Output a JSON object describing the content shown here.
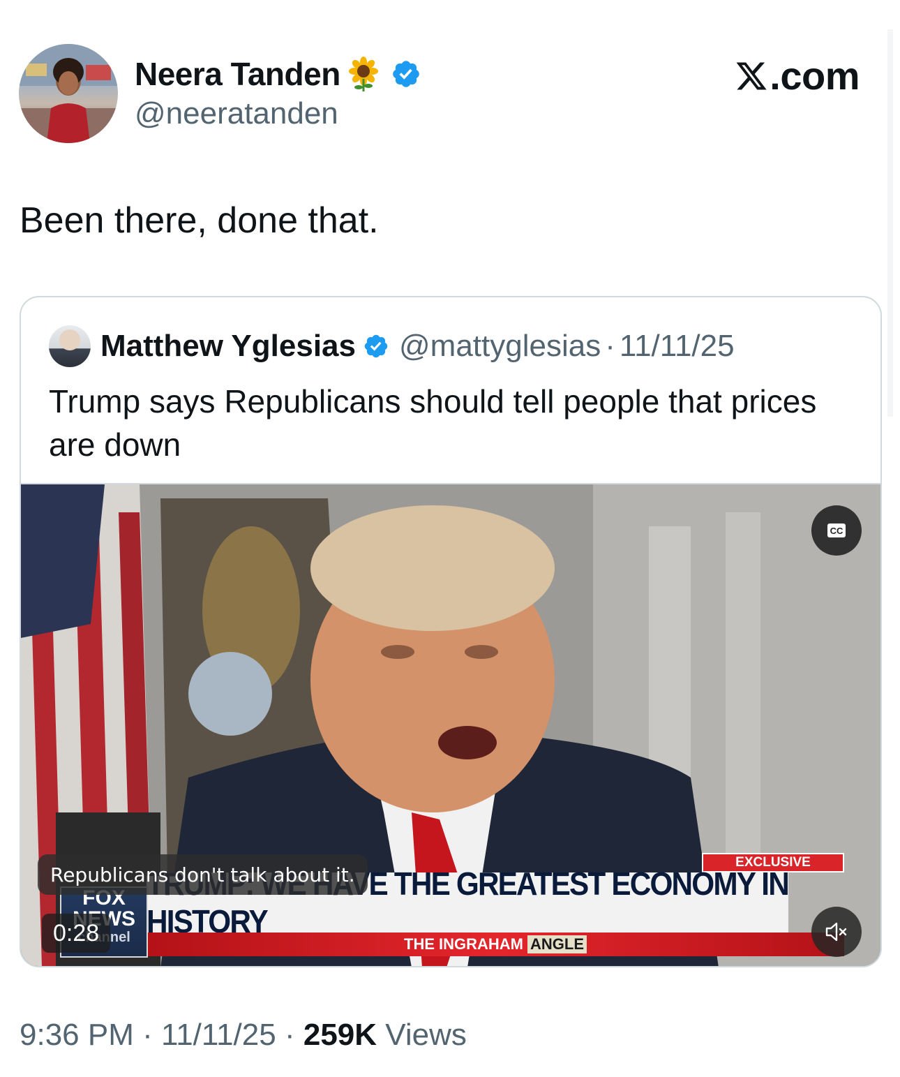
{
  "author": {
    "name": "Neera Tanden",
    "handle": "@neeratanden",
    "name_emoji": "sunflower-icon",
    "verified": true
  },
  "site_label": ".com",
  "tweet": {
    "text": "Been there, done that."
  },
  "quoted_tweet": {
    "name": "Matthew Yglesias",
    "handle": "@mattyglesias",
    "separator": "·",
    "date": "11/11/25",
    "verified": true,
    "text": "Trump says Republicans should tell people that prices are down",
    "video": {
      "caption": "Republicans don't talk about it.",
      "duration": "0:28",
      "cc_label": "CC",
      "chyron": {
        "tag": "EXCLUSIVE",
        "headline": "TRUMP: WE HAVE THE GREATEST ECONOMY IN HISTORY",
        "show_prefix": "THE",
        "show_name": "INGRAHAM",
        "show_suffix": "ANGLE"
      },
      "network_logo": {
        "line1": "FOX",
        "line2": "NEWS",
        "line3": "channel"
      }
    }
  },
  "meta": {
    "time": "9:36 PM",
    "sep1": " · ",
    "date": "11/11/25",
    "sep2": " · ",
    "views_count": "259K",
    "views_label": "Views"
  },
  "colors": {
    "verified_blue": "#1d9bf0",
    "secondary_text": "#536471",
    "primary_text": "#0f1419",
    "border": "#cfd9de"
  }
}
